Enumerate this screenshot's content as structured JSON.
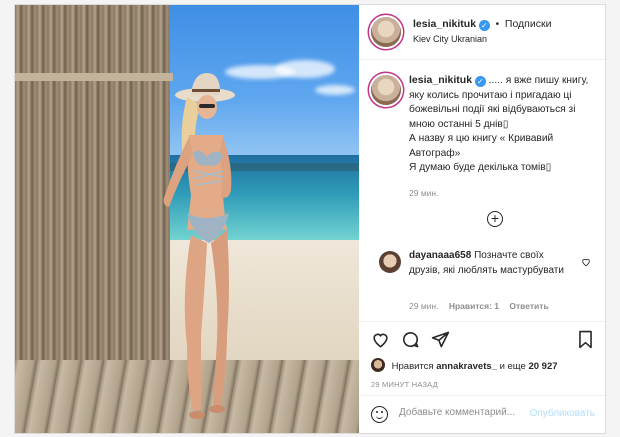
{
  "header": {
    "username": "lesia_nikituk",
    "verified_badge": "✓",
    "separator": "•",
    "follow_label": "Подписки",
    "location": "Kiev City Ukranian",
    "more_icon": "more-dots-icon"
  },
  "caption": {
    "username": "lesia_nikituk",
    "verified_badge": "✓",
    "line1": "..... я вже пишу книгу, яку колись прочитаю і пригадаю ці божевільні події які відбуваються зі мною останні 5 днів",
    "line2": "А назву я цю книгу « Кривавий Автограф»",
    "line3": "Я думаю буде декілька томів",
    "time": "29 мин."
  },
  "load_more_icon": "plus-circle-icon",
  "load_more_symbol": "+",
  "comment": {
    "username": "dayanaaa658",
    "text": "Позначте своїх друзів, які люблять мастурбувати",
    "time": "29 мин.",
    "likes": "Нравится: 1",
    "reply": "Ответить"
  },
  "actions": {
    "like_icon": "heart-icon",
    "comment_icon": "comment-bubble-icon",
    "share_icon": "paper-plane-icon",
    "save_icon": "bookmark-icon"
  },
  "likes": {
    "prefix": "Нравится",
    "user": "annakravets_",
    "middle": "и еще",
    "count": "20 927"
  },
  "posted_ago": "29 МИНУТ НАЗАД",
  "add_comment": {
    "placeholder": "Добавьте комментарий...",
    "publish_label": "Опубликовать"
  },
  "colors": {
    "accent": "#3897f0",
    "publish_disabled": "#b2dffc",
    "muted": "#8e8e8e"
  }
}
